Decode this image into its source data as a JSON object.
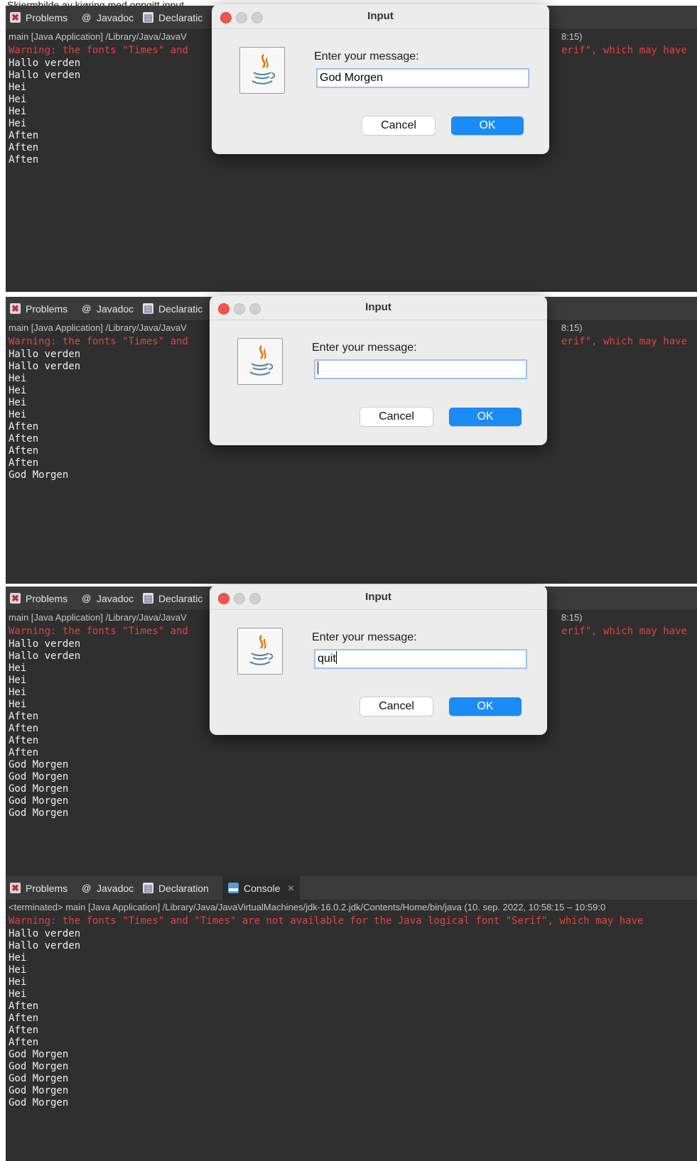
{
  "caption": "Skjermbilde av kjøring med oppgitt input",
  "panels": [
    {
      "tabs": {
        "problems": "Problems",
        "javadoc": "Javadoc",
        "declaration": "Declaratic"
      },
      "path": "main [Java Application] /Library/Java/JavaV",
      "time_fragment": "8:15)",
      "warning": "Warning: the fonts \"Times\" and",
      "warning_tail": "erif\", which may have",
      "lines": [
        "Hallo verden",
        "Hallo verden",
        "Hei",
        "Hei",
        "Hei",
        "Hei",
        "Aften",
        "Aften",
        "Aften"
      ],
      "dialog": {
        "title": "Input",
        "label": "Enter your message:",
        "input_value": "God Morgen",
        "cancel": "Cancel",
        "ok": "OK"
      }
    },
    {
      "tabs": {
        "problems": "Problems",
        "javadoc": "Javadoc",
        "declaration": "Declaratic"
      },
      "path": "main [Java Application] /Library/Java/JavaV",
      "time_fragment": "8:15)",
      "warning": "Warning: the fonts \"Times\" and",
      "warning_tail": "erif\", which may have",
      "lines": [
        "Hallo verden",
        "Hallo verden",
        "Hei",
        "Hei",
        "Hei",
        "Hei",
        "Aften",
        "Aften",
        "Aften",
        "Aften",
        "God Morgen"
      ],
      "dialog": {
        "title": "Input",
        "label": "Enter your message:",
        "input_value": "",
        "cancel": "Cancel",
        "ok": "OK"
      }
    },
    {
      "tabs": {
        "problems": "Problems",
        "javadoc": "Javadoc",
        "declaration": "Declaratic"
      },
      "path": "main [Java Application] /Library/Java/JavaV",
      "time_fragment": "8:15)",
      "warning": "Warning: the fonts \"Times\" and",
      "warning_tail": "erif\", which may have",
      "lines": [
        "Hallo verden",
        "Hallo verden",
        "Hei",
        "Hei",
        "Hei",
        "Hei",
        "Aften",
        "Aften",
        "Aften",
        "Aften",
        "God Morgen",
        "God Morgen",
        "God Morgen",
        "God Morgen",
        "God Morgen"
      ],
      "dialog": {
        "title": "Input",
        "label": "Enter your message:",
        "input_value": "quit",
        "cancel": "Cancel",
        "ok": "OK"
      }
    },
    {
      "tabs": {
        "problems": "Problems",
        "javadoc": "Javadoc",
        "declaration": "Declaration",
        "console": "Console"
      },
      "path": "<terminated> main [Java Application] /Library/Java/JavaVirtualMachines/jdk-16.0.2.jdk/Contents/Home/bin/java  (10. sep. 2022, 10:58:15 – 10:59:0",
      "warning": "Warning: the fonts \"Times\" and \"Times\" are not available for the Java logical font \"Serif\", which may have",
      "lines": [
        "Hallo verden",
        "Hallo verden",
        "Hei",
        "Hei",
        "Hei",
        "Hei",
        "Aften",
        "Aften",
        "Aften",
        "Aften",
        "God Morgen",
        "God Morgen",
        "God Morgen",
        "God Morgen",
        "God Morgen"
      ]
    }
  ]
}
